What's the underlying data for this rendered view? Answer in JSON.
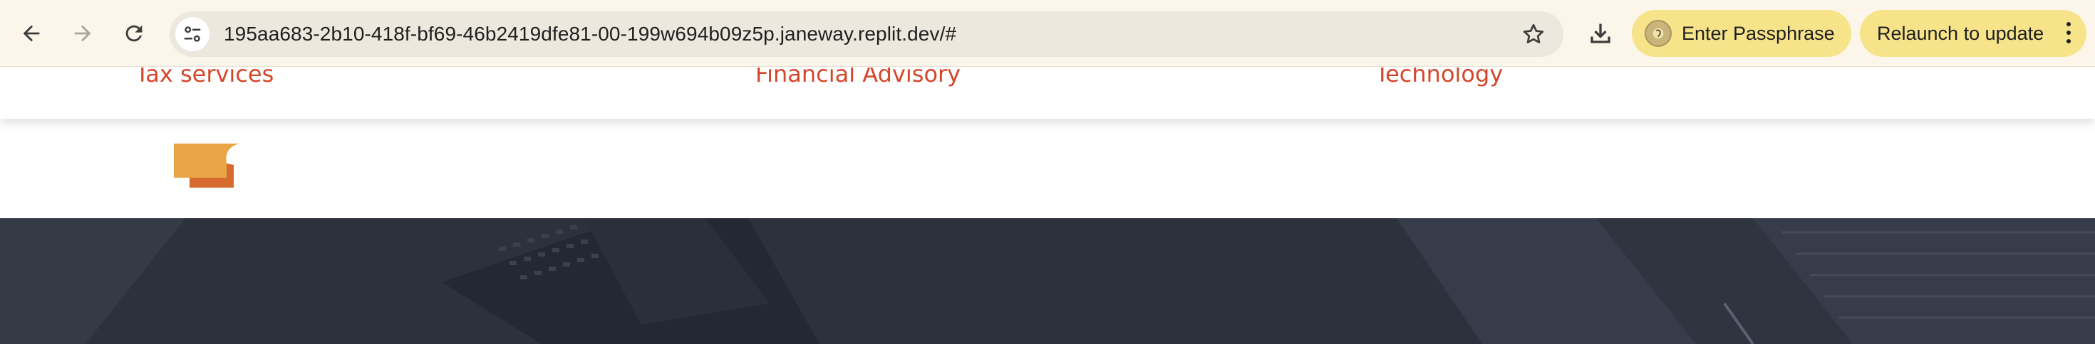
{
  "browser": {
    "url": "195aa683-2b10-418f-bf69-46b2419dfe81-00-199w694b09z5p.janeway.replit.dev/#",
    "passphrase_label": "Enter Passphrase",
    "relaunch_label": "Relaunch to update",
    "icons": {
      "back": "arrow-left-icon",
      "forward": "arrow-right-icon",
      "reload": "reload-icon",
      "site_info": "tune-icon",
      "bookmark": "star-icon",
      "download": "download-icon",
      "menu": "kebab-icon"
    },
    "colors": {
      "toolbar": "#fbf6e9",
      "omnibox": "#ede8dd",
      "pill": "#f6e38a"
    }
  },
  "nav": {
    "items": [
      {
        "label": "Tax services"
      },
      {
        "label": "Financial Advisory"
      },
      {
        "label": "Technology"
      }
    ],
    "link_color": "#d5472a"
  },
  "hero": {
    "background": "#2c313d"
  },
  "logo": {
    "primary": "#e8a445",
    "secondary": "#d66b2f"
  }
}
